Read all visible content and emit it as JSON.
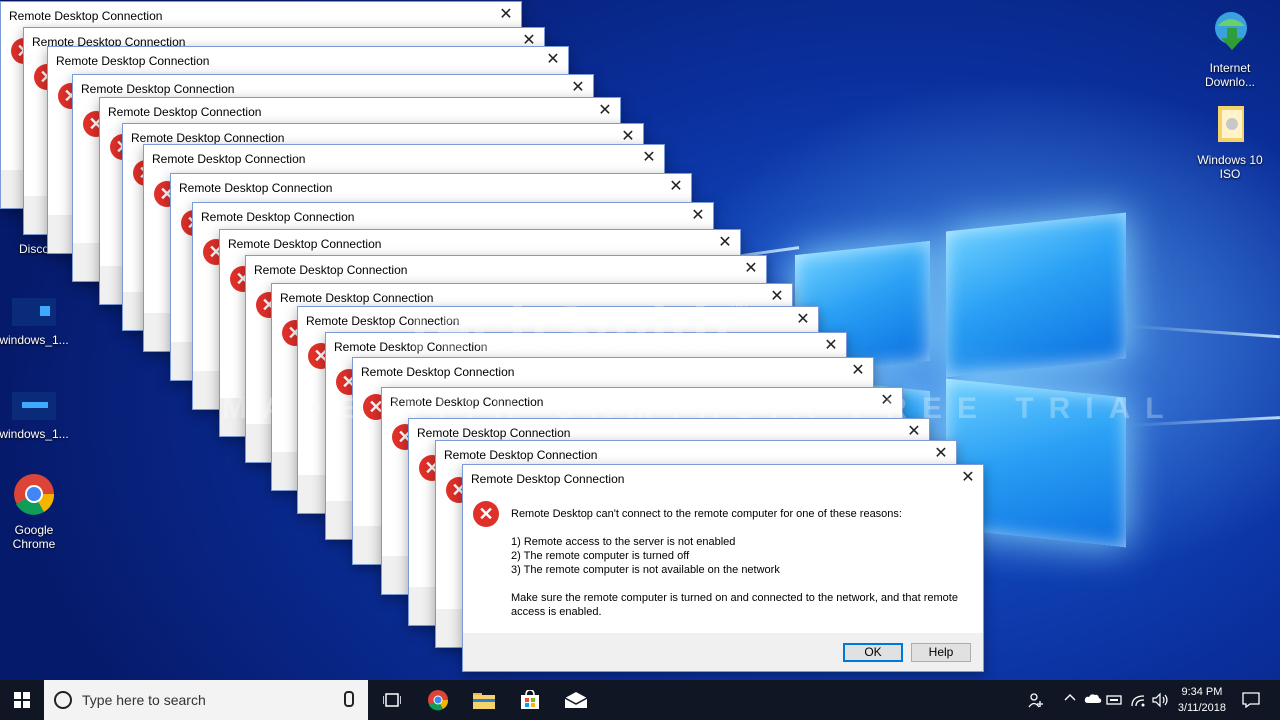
{
  "colors": {
    "accent": "#0078d7",
    "error": "#e0302a",
    "taskbar": "#101624"
  },
  "desktop": {
    "icons": [
      {
        "label": "Internet Downlo...",
        "icon": "download-manager-icon"
      },
      {
        "label": "Windows 10 ISO",
        "icon": "folder-icon"
      },
      {
        "label": "Disco",
        "icon": "discord-icon"
      },
      {
        "label": "windows_1...",
        "icon": "video-file-icon"
      },
      {
        "label": "windows_1...",
        "icon": "video-file-icon"
      },
      {
        "label": "Google Chrome",
        "icon": "chrome-icon"
      }
    ],
    "watermark_line1": "TechSmith",
    "watermark_registered": "®",
    "watermark_line2": "MADE WITH CAMTASIA FREE TRIAL"
  },
  "dialog": {
    "title": "Remote Desktop Connection",
    "close_glyph": "✕",
    "message_intro": "Remote Desktop can't connect to the remote computer for one of these reasons:",
    "reasons": [
      "1) Remote access to the server is not enabled",
      "2) The remote computer is turned off",
      "3) The remote computer is not available on the network"
    ],
    "message_outro": "Make sure the remote computer is turned on and connected to the network, and that remote access is enabled.",
    "ok_label": "OK",
    "help_label": "Help"
  },
  "taskbar": {
    "search_placeholder": "Type here to search",
    "time": "9:34 PM",
    "date": "3/11/2018"
  }
}
